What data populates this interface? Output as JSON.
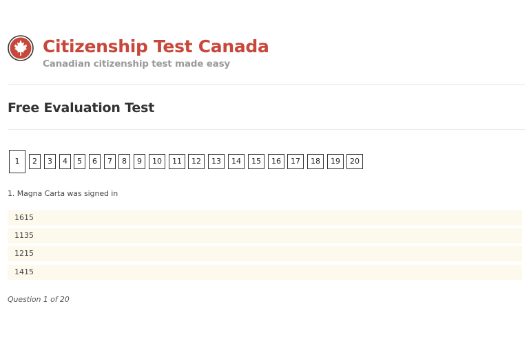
{
  "header": {
    "site_title": "Citizenship Test Canada",
    "tagline": "Canadian citizenship test made easy",
    "logo_icon": "maple-leaf-icon",
    "brand_color": "#c8473b"
  },
  "page_title": "Free Evaluation Test",
  "pager": {
    "pages": [
      "1",
      "2",
      "3",
      "4",
      "5",
      "6",
      "7",
      "8",
      "9",
      "10",
      "11",
      "12",
      "13",
      "14",
      "15",
      "16",
      "17",
      "18",
      "19",
      "20"
    ],
    "current": "1"
  },
  "question": {
    "text": "1. Magna Carta was signed in",
    "answers": [
      "1615",
      "1135",
      "1215",
      "1415"
    ]
  },
  "progress_text": "Question 1 of 20"
}
